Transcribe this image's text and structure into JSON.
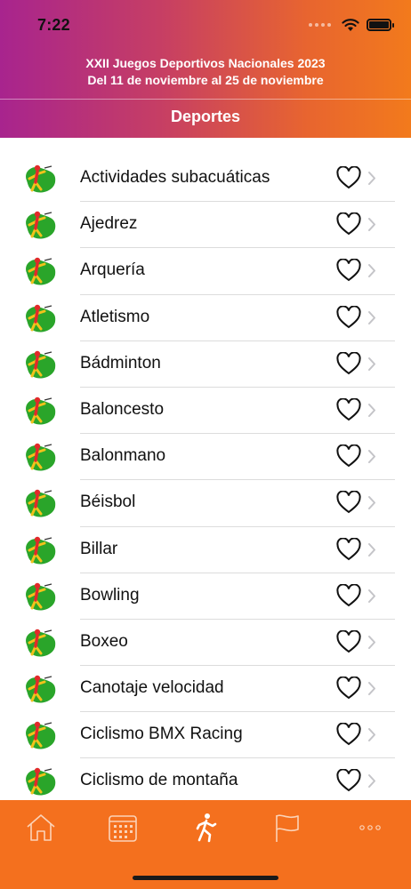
{
  "status": {
    "time": "7:22"
  },
  "header": {
    "event_line1": "XXII Juegos Deportivos Nacionales 2023",
    "event_line2": "Del 11 de noviembre al 25 de noviembre",
    "title": "Deportes"
  },
  "colors": {
    "brand_gradient_start": "#a8248e",
    "brand_gradient_end": "#f27a1c",
    "tabbar": "#f4701e",
    "icon_green": "#2aa52a",
    "icon_red": "#e12a2a",
    "icon_yellow": "#f2c21b"
  },
  "sports": [
    {
      "label": "Actividades subacuáticas",
      "icon": "underwater-sport-icon"
    },
    {
      "label": "Ajedrez",
      "icon": "chess-icon"
    },
    {
      "label": "Arquería",
      "icon": "archery-icon"
    },
    {
      "label": "Atletismo",
      "icon": "athletics-icon"
    },
    {
      "label": "Bádminton",
      "icon": "badminton-icon"
    },
    {
      "label": "Baloncesto",
      "icon": "basketball-icon"
    },
    {
      "label": "Balonmano",
      "icon": "handball-icon"
    },
    {
      "label": "Béisbol",
      "icon": "baseball-icon"
    },
    {
      "label": "Billar",
      "icon": "billiards-icon"
    },
    {
      "label": "Bowling",
      "icon": "bowling-icon"
    },
    {
      "label": "Boxeo",
      "icon": "boxing-icon"
    },
    {
      "label": "Canotaje velocidad",
      "icon": "canoe-icon"
    },
    {
      "label": "Ciclismo BMX Racing",
      "icon": "bmx-icon"
    },
    {
      "label": "Ciclismo de montaña",
      "icon": "mountain-bike-icon"
    }
  ],
  "tabbar": {
    "tabs": [
      {
        "name": "home-icon",
        "selected": false
      },
      {
        "name": "calendar-icon",
        "selected": false
      },
      {
        "name": "sports-icon",
        "selected": true
      },
      {
        "name": "flag-icon",
        "selected": false
      },
      {
        "name": "more-icon",
        "selected": false
      }
    ]
  }
}
